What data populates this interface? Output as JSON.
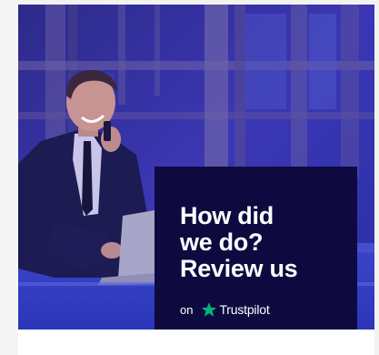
{
  "promo": {
    "headline_lines": [
      "How did",
      "we do?",
      "Review us"
    ],
    "on_label": "on",
    "brand_name": "Trustpilot",
    "brand_icon": "trustpilot-star-icon"
  },
  "colors": {
    "panel_bg": "#0e0a3f",
    "star_green": "#00b67a",
    "hero_tint": "#3a2fb0"
  }
}
